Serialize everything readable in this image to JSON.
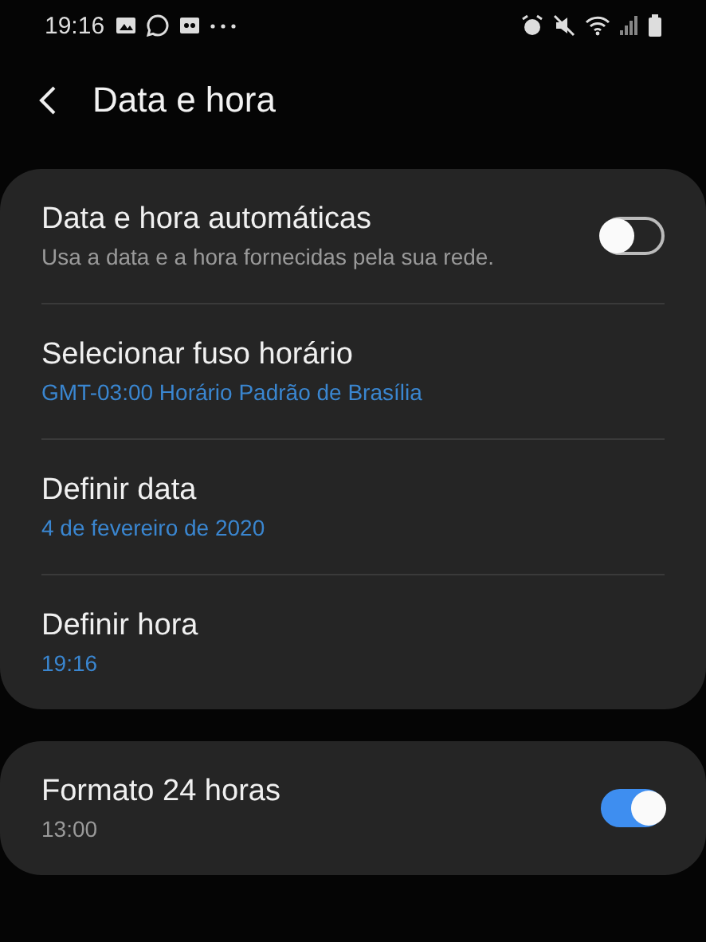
{
  "status_bar": {
    "time": "19:16"
  },
  "header": {
    "title": "Data e hora"
  },
  "cards": [
    {
      "rows": [
        {
          "kind": "switch",
          "title": "Data e hora automáticas",
          "subtitle": "Usa a data e a hora fornecidas pela sua rede.",
          "on": false
        },
        {
          "kind": "link",
          "title": "Selecionar fuso horário",
          "subtitle": "GMT-03:00 Horário Padrão de Brasília"
        },
        {
          "kind": "link",
          "title": "Definir data",
          "subtitle": "4 de fevereiro de 2020"
        },
        {
          "kind": "link",
          "title": "Definir hora",
          "subtitle": "19:16"
        }
      ]
    },
    {
      "rows": [
        {
          "kind": "switch",
          "title": "Formato 24 horas",
          "subtitle": "13:00",
          "on": true
        }
      ]
    }
  ]
}
